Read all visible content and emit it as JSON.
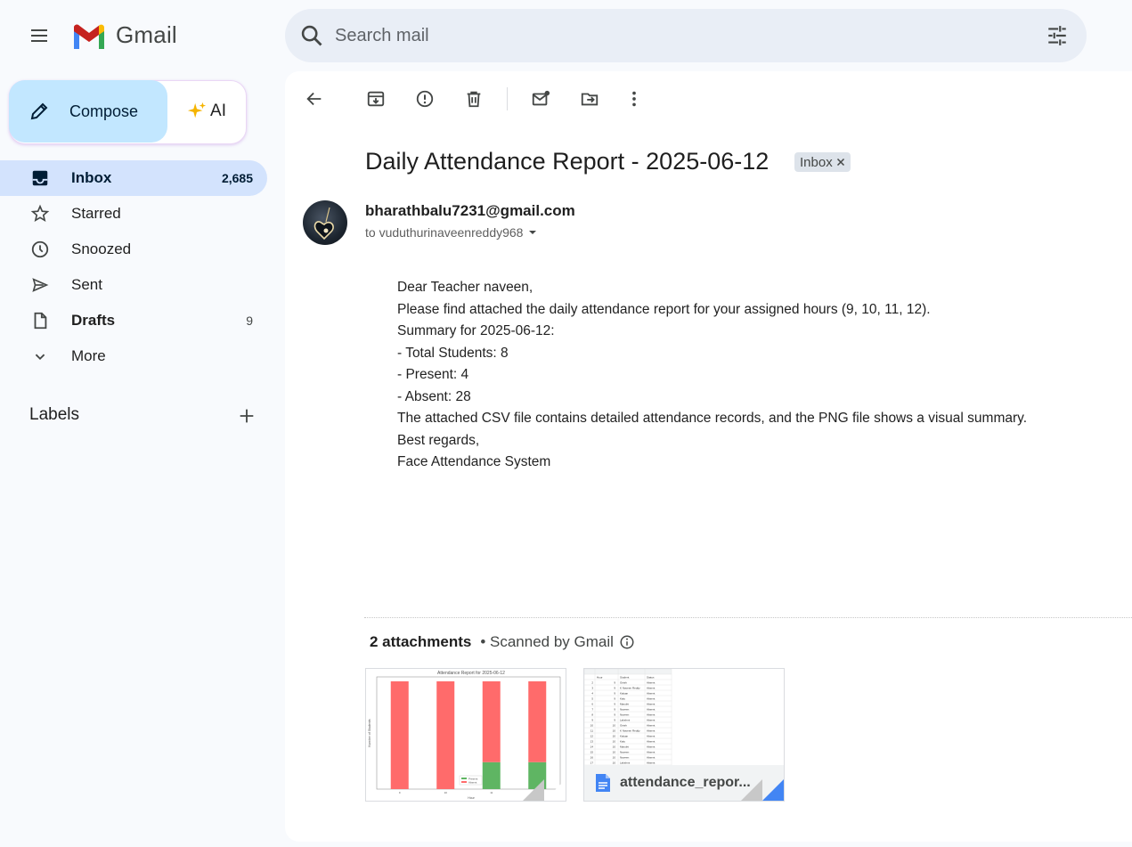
{
  "app": {
    "name": "Gmail",
    "search_placeholder": "Search mail"
  },
  "compose": {
    "label": "Compose",
    "ai_label": "AI"
  },
  "sidebar": {
    "items": [
      {
        "label": "Inbox",
        "count": "2,685",
        "icon": "inbox-icon",
        "active": true
      },
      {
        "label": "Starred",
        "count": "",
        "icon": "star-icon"
      },
      {
        "label": "Snoozed",
        "count": "",
        "icon": "clock-icon"
      },
      {
        "label": "Sent",
        "count": "",
        "icon": "send-icon"
      },
      {
        "label": "Drafts",
        "count": "9",
        "icon": "draft-icon"
      },
      {
        "label": "More",
        "count": "",
        "icon": "chevron-down-icon"
      }
    ],
    "labels_heading": "Labels"
  },
  "email": {
    "subject": "Daily Attendance Report - 2025-06-12",
    "label_chip": "Inbox",
    "sender": "bharathbalu7231@gmail.com",
    "to": "to vuduthurinaveenreddy968",
    "body": [
      "Dear Teacher naveen,",
      "",
      "Please find attached the daily attendance report for your assigned hours (9, 10, 11, 12).",
      "",
      "Summary for 2025-06-12:",
      "- Total Students: 8",
      "- Present: 4",
      "- Absent: 28",
      "",
      "The attached CSV file contains detailed attendance records, and the PNG file shows a visual summary.",
      "",
      "Best regards,",
      "Face Attendance System"
    ]
  },
  "attachments": {
    "heading": "2 attachments",
    "scan_note": "• Scanned by Gmail",
    "files": [
      {
        "name": "Attendance Report for 2025-06-12",
        "kind": "png-chart"
      },
      {
        "name": "attendance_repor..."
      }
    ]
  },
  "chart_preview": {
    "title": "Attendance Report for 2025-06-12",
    "xlabel": "Hour",
    "ylabel": "Number of Students",
    "categories": [
      "9",
      "10",
      "11",
      "12"
    ],
    "absent": [
      8,
      8,
      6,
      6
    ],
    "present": [
      0,
      0,
      2,
      2
    ],
    "legend": [
      "Present",
      "Absent"
    ],
    "colors": {
      "present": "#5fb563",
      "absent": "#ff6b6b"
    }
  },
  "csv_preview": {
    "cols": [
      "Hour",
      "Student",
      "Status"
    ],
    "rows": [
      [
        "9",
        "Girish",
        "Absent"
      ],
      [
        "9",
        "K Naveen Reddy",
        "Absent"
      ],
      [
        "9",
        "Kalyan",
        "Absent"
      ],
      [
        "9",
        "Kalu",
        "Absent"
      ],
      [
        "9",
        "Maruthi",
        "Absent"
      ],
      [
        "9",
        "Naveen",
        "Absent"
      ],
      [
        "9",
        "Naveen",
        "Absent"
      ],
      [
        "9",
        "Lakshmi",
        "Absent"
      ],
      [
        "10",
        "Girish",
        "Absent"
      ],
      [
        "10",
        "K Naveen Reddy",
        "Absent"
      ],
      [
        "10",
        "Kalyan",
        "Absent"
      ],
      [
        "10",
        "Kalu",
        "Absent"
      ],
      [
        "10",
        "Maruthi",
        "Absent"
      ],
      [
        "10",
        "Naveen",
        "Absent"
      ],
      [
        "10",
        "Naveen",
        "Absent"
      ],
      [
        "10",
        "Lakshmi",
        "Absent"
      ]
    ]
  }
}
